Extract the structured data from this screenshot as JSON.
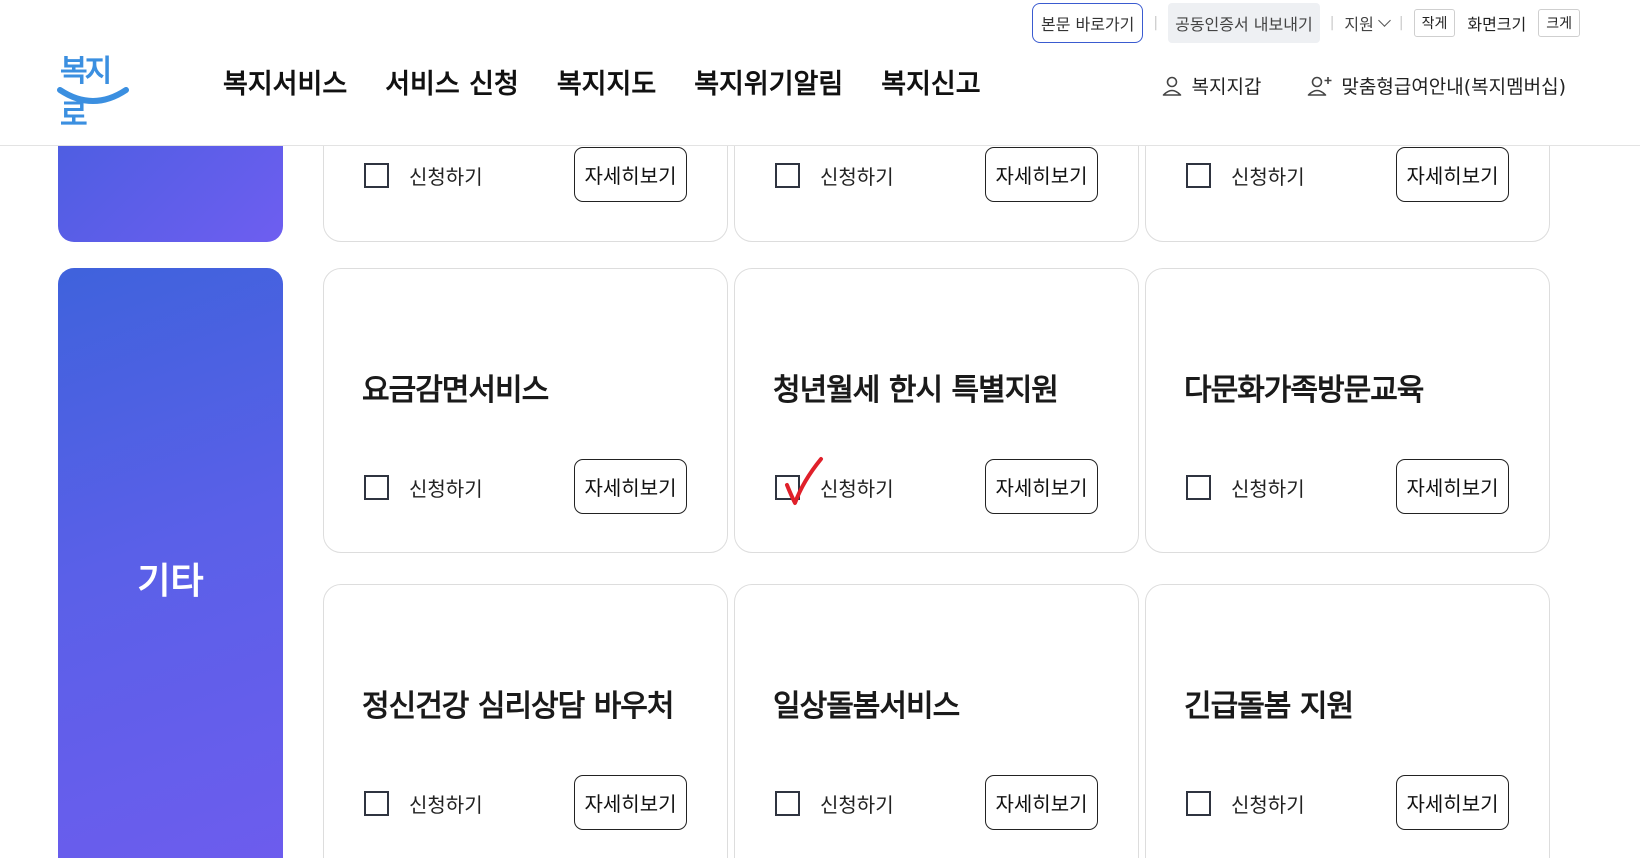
{
  "header": {
    "util": {
      "skip_link": "본문 바로가기",
      "cert_export": "공동인증서 내보내기",
      "support": "지원",
      "font_small": "작게",
      "font_size_label": "화면크기",
      "font_large": "크게"
    },
    "logo_text": "복지로",
    "nav": [
      "복지서비스",
      "서비스 신청",
      "복지지도",
      "복지위기알림",
      "복지신고"
    ],
    "user_links": {
      "wallet": "복지지갑",
      "membership": "맞춤형급여안내(복지멤버십)"
    }
  },
  "categories": {
    "other_label": "기타"
  },
  "common": {
    "apply_label": "신청하기",
    "detail_label": "자세히보기"
  },
  "cards": {
    "top_row": [
      {
        "checked": false
      },
      {
        "checked": false
      },
      {
        "checked": false
      }
    ],
    "row1": [
      {
        "title": "요금감면서비스",
        "checked": false
      },
      {
        "title": "청년월세 한시 특별지원",
        "checked": true
      },
      {
        "title": "다문화가족방문교육",
        "checked": false
      }
    ],
    "row2": [
      {
        "title": "정신건강 심리상담 바우처",
        "checked": false
      },
      {
        "title": "일상돌봄서비스",
        "checked": false
      },
      {
        "title": "긴급돌봄 지원",
        "checked": false
      }
    ]
  },
  "colors": {
    "category_gradient_start": "#3f62dc",
    "category_gradient_end": "#6e5cee",
    "check_mark": "#e0202a",
    "logo_blue": "#3b8fe0"
  }
}
